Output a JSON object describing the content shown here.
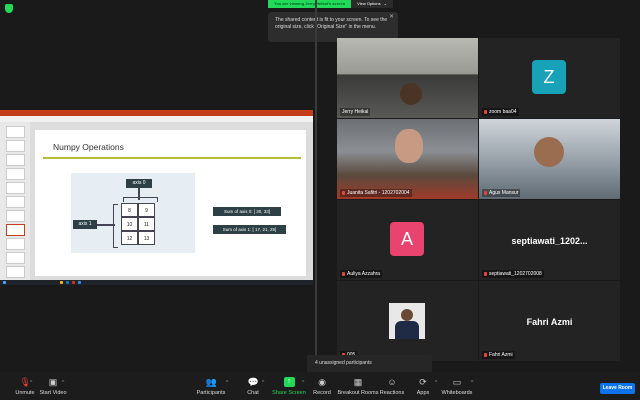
{
  "banner": {
    "viewing": "You are viewing Jerry Heikal's screen",
    "view_options": "View Options"
  },
  "tooltip": {
    "text": "The shared content is fit to your screen. To see the original size, click \"Original Size\" in the menu."
  },
  "slide": {
    "title": "Numpy Operations",
    "axis0": "axis 0",
    "axis1": "axis 1",
    "cells": [
      "8",
      "9",
      "10",
      "11",
      "12",
      "13"
    ],
    "sum_axis0": "Sum of axis 0: [ 30, 33]",
    "sum_axis1": "Sum of axis 1: [ 17, 21, 25]"
  },
  "participants": [
    {
      "name": "Jerry Heikal",
      "muted": false
    },
    {
      "name": "zoom baa04",
      "muted": true,
      "initial": "Z",
      "color": "#17a2b8"
    },
    {
      "name": "Juanita Safitri - 1202702004",
      "muted": true
    },
    {
      "name": "Agus Mansur",
      "muted": true
    },
    {
      "name": "Auliya Azzahra",
      "muted": true,
      "initial": "A",
      "color": "#e9436f"
    },
    {
      "name": "septiawati_1202702008",
      "muted": true,
      "display": "septiawati_1202..."
    },
    {
      "name": "005",
      "muted": true
    },
    {
      "name": "Fahri Azmi",
      "muted": true,
      "display": "Fahri Azmi"
    }
  ],
  "unassigned": "4 unassigned participants",
  "toolbar": {
    "unmute": "Unmute",
    "start_video": "Start Video",
    "participants": "Participants",
    "chat": "Chat",
    "share_screen": "Share Screen",
    "record": "Record",
    "breakout": "Breakout Rooms",
    "reactions": "Reactions",
    "apps": "Apps",
    "whiteboards": "Whiteboards",
    "leave": "Leave Room",
    "participant_count": "13",
    "breakout_count": "2"
  }
}
